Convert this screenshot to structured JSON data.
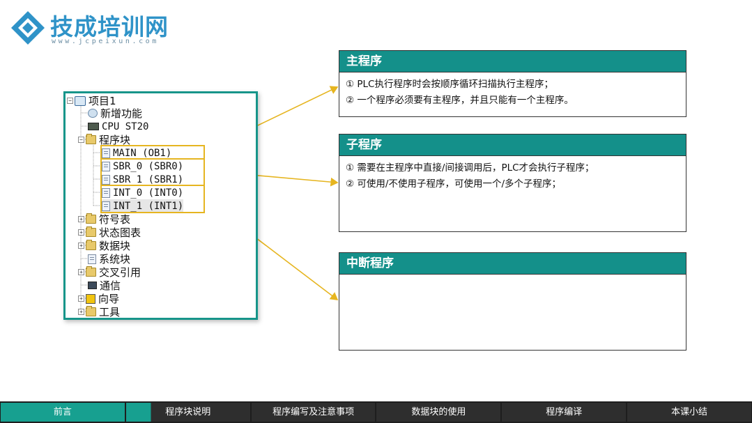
{
  "logo": {
    "title": "技成培训网",
    "url": "www.jcpeixun.com"
  },
  "tree": {
    "root": "项目1",
    "items": [
      {
        "label": "新增功能",
        "icon": "new-feature-icon",
        "cjk": true
      },
      {
        "label": "CPU ST20",
        "icon": "cpu-icon",
        "cjk": false
      },
      {
        "label": "程序块",
        "icon": "folder-icon",
        "cjk": true
      },
      {
        "label": "MAIN (OB1)",
        "icon": "program-block-icon",
        "cjk": false
      },
      {
        "label": "SBR_0 (SBR0)",
        "icon": "program-block-icon",
        "cjk": false
      },
      {
        "label": "SBR_1 (SBR1)",
        "icon": "program-block-icon",
        "cjk": false
      },
      {
        "label": "INT_0 (INT0)",
        "icon": "program-block-icon",
        "cjk": false
      },
      {
        "label": "INT_1 (INT1)",
        "icon": "program-block-icon",
        "cjk": false
      },
      {
        "label": "符号表",
        "icon": "folder-icon",
        "cjk": true
      },
      {
        "label": "状态图表",
        "icon": "folder-icon",
        "cjk": true
      },
      {
        "label": "数据块",
        "icon": "folder-icon",
        "cjk": true
      },
      {
        "label": "系统块",
        "icon": "system-block-icon",
        "cjk": true
      },
      {
        "label": "交叉引用",
        "icon": "folder-icon",
        "cjk": true
      },
      {
        "label": "通信",
        "icon": "communication-icon",
        "cjk": true
      },
      {
        "label": "向导",
        "icon": "wizard-icon",
        "cjk": true
      },
      {
        "label": "工具",
        "icon": "folder-icon",
        "cjk": true
      }
    ]
  },
  "boxes": {
    "main": {
      "title": "主程序",
      "lines": [
        "① PLC执行程序时会按顺序循环扫描执行主程序；",
        "② 一个程序必须要有主程序，并且只能有一个主程序。"
      ]
    },
    "sub": {
      "title": "子程序",
      "lines": [
        "① 需要在主程序中直接/间接调用后，PLC才会执行子程序；",
        "② 可使用/不使用子程序，可使用一个/多个子程序；"
      ]
    },
    "interrupt": {
      "title": "中断程序"
    }
  },
  "nav": {
    "items": [
      "前言",
      "程序块说明",
      "程序编写及注意事项",
      "数据块的使用",
      "程序编译",
      "本课小结"
    ]
  },
  "colors": {
    "accent": "#17958a",
    "highlight": "#e6b520",
    "logo": "#2f93c8"
  }
}
